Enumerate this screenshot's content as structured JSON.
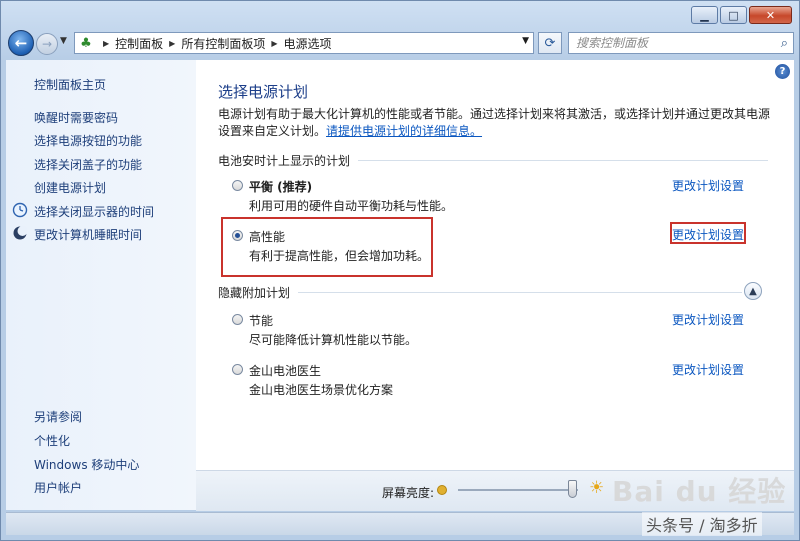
{
  "window": {
    "caption_buttons": [
      "minimize",
      "maximize",
      "close"
    ]
  },
  "navbar": {
    "breadcrumb": [
      "控制面板",
      "所有控制面板项",
      "电源选项"
    ],
    "search_placeholder": "搜索控制面板"
  },
  "sidebar": {
    "home": "控制面板主页",
    "links": [
      "唤醒时需要密码",
      "选择电源按钮的功能",
      "选择关闭盖子的功能",
      "创建电源计划",
      "选择关闭显示器的时间",
      "更改计算机睡眠时间"
    ],
    "see_also_title": "另请参阅",
    "see_also": [
      "个性化",
      "Windows 移动中心",
      "用户帐户"
    ]
  },
  "main": {
    "title": "选择电源计划",
    "description": "电源计划有助于最大化计算机的性能或者节能。通过选择计划来将其激活，或选择计划并通过更改其电源设置来自定义计划。",
    "description_link": "请提供电源计划的详细信息。",
    "battery_section": "电池安时计上显示的计划",
    "hidden_section": "隐藏附加计划",
    "change_label": "更改计划设置",
    "plans": [
      {
        "name": "平衡 (推荐)",
        "desc": "利用可用的硬件自动平衡功耗与性能。",
        "selected": false
      },
      {
        "name": "高性能",
        "desc": "有利于提高性能，但会增加功耗。",
        "selected": true
      },
      {
        "name": "节能",
        "desc": "尽可能降低计算机性能以节能。",
        "selected": false
      },
      {
        "name": "金山电池医生",
        "desc": "金山电池医生场景优化方案",
        "selected": false
      }
    ]
  },
  "brightness": {
    "label": "屏幕亮度:",
    "level_percent": 95
  },
  "watermark": {
    "logo": "Bai du 经验",
    "credit": "头条号 / 淘多折"
  }
}
